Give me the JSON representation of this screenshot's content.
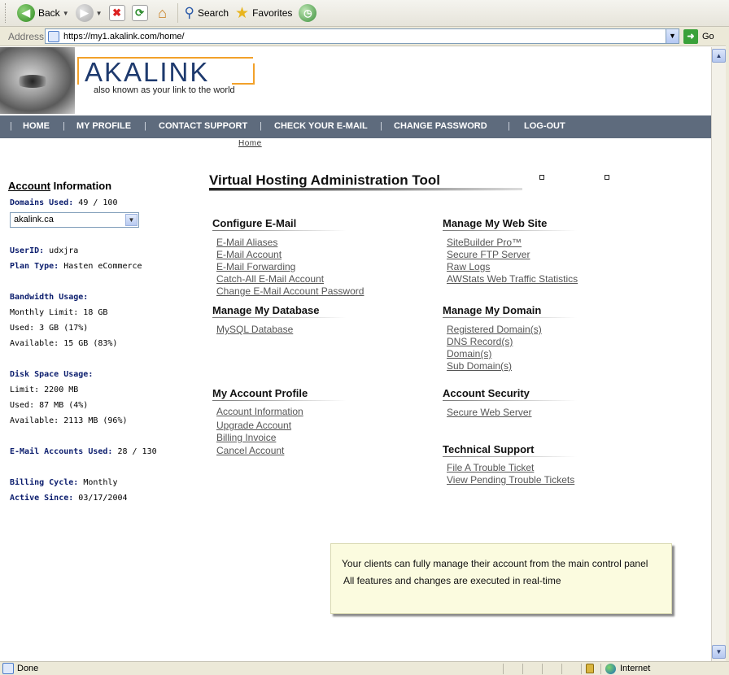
{
  "toolbar": {
    "back_label": "Back",
    "search_label": "Search",
    "favorites_label": "Favorites"
  },
  "address_bar": {
    "label": "Address",
    "url": "https://my1.akalink.com/home/",
    "go_label": "Go"
  },
  "header": {
    "logo_text": "AKALINK",
    "tagline": "also known as your link to the world"
  },
  "nav": {
    "items": [
      "HOME",
      "MY PROFILE",
      "CONTACT SUPPORT",
      "CHECK YOUR E-MAIL",
      "CHANGE PASSWORD",
      "LOG-OUT"
    ]
  },
  "breadcrumb": {
    "home": "Home"
  },
  "sidebar": {
    "title_account": "Account",
    "title_information": " Information",
    "domains_used_label": "Domains Used:",
    "domains_used_value": " 49 / 100",
    "domain_selected": "akalink.ca",
    "userid_label": "UserID:",
    "userid_value": " udxjra",
    "plan_label": "Plan Type:",
    "plan_value": " Hasten eCommerce",
    "bandwidth_label": "Bandwidth Usage:",
    "bw_limit": "Monthly Limit: 18 GB",
    "bw_used": "Used: 3 GB (17%)",
    "bw_available": "Available: 15 GB (83%)",
    "disk_label": "Disk Space Usage:",
    "disk_limit": "Limit: 2200 MB",
    "disk_used": "Used: 87 MB (4%)",
    "disk_available": "Available: 2113 MB (96%)",
    "email_label": "E-Mail Accounts Used:",
    "email_value": " 28 / 130",
    "billing_label": "Billing Cycle:",
    "billing_value": " Monthly",
    "active_label": "Active Since:",
    "active_value": " 03/17/2004"
  },
  "main": {
    "title": "Virtual Hosting Administration Tool",
    "sections": {
      "email": {
        "title": "Configure E-Mail",
        "links": [
          "E-Mail Aliases",
          "E-Mail Account",
          "E-Mail Forwarding",
          "Catch-All E-Mail Account",
          "Change E-Mail Account Password"
        ]
      },
      "website": {
        "title": "Manage My Web Site",
        "links": [
          "SiteBuilder Pro™",
          "Secure FTP Server",
          "Raw Logs",
          "AWStats Web Traffic Statistics"
        ]
      },
      "database": {
        "title": "Manage My Database",
        "links": [
          "MySQL Database"
        ]
      },
      "domain": {
        "title": "Manage My Domain",
        "links": [
          "Registered Domain(s)",
          "DNS Record(s)",
          "Domain(s)",
          "Sub Domain(s)"
        ]
      },
      "profile": {
        "title": "My Account Profile",
        "links": [
          "Account Information",
          "Upgrade Account",
          "Billing Invoice",
          "Cancel Account"
        ]
      },
      "security": {
        "title": "Account Security",
        "links": [
          "Secure Web Server"
        ]
      },
      "support": {
        "title": "Technical Support",
        "links": [
          "File A Trouble Ticket",
          "View Pending Trouble Tickets"
        ]
      }
    }
  },
  "note": {
    "line1": "Your clients can fully manage their account from the main control panel",
    "line2": "All features and changes are executed in real-time"
  },
  "status": {
    "text": "Done",
    "zone": "Internet"
  }
}
